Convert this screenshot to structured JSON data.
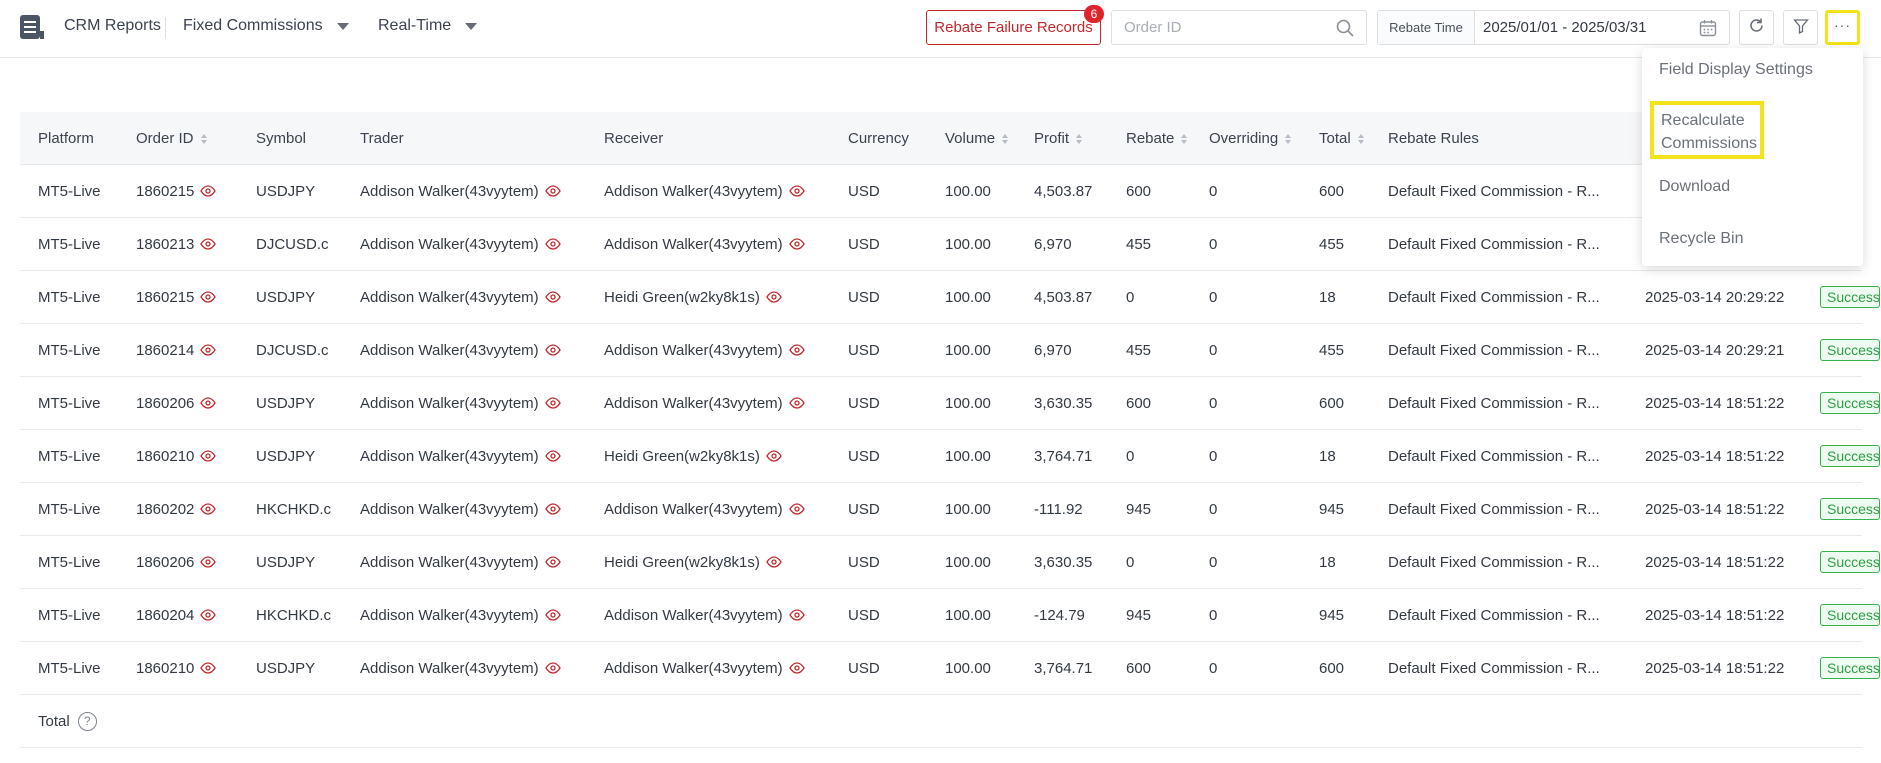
{
  "header": {
    "app_title": "CRM Reports",
    "report_type": "Fixed Commissions",
    "mode": "Real-Time",
    "failure_button": "Rebate Failure Records",
    "failure_count": "6",
    "search_placeholder": "Order ID",
    "date_label": "Rebate Time",
    "date_range": "2025/01/01 - 2025/03/31",
    "more_label": "···"
  },
  "menu": {
    "items": [
      "Field Display Settings",
      "Recalculate Commissions",
      "Download",
      "Recycle Bin"
    ]
  },
  "table": {
    "columns": [
      "Platform",
      "Order ID",
      "Symbol",
      "Trader",
      "Receiver",
      "Currency",
      "Volume",
      "Profit",
      "Rebate",
      "Overriding",
      "Total",
      "Rebate Rules"
    ],
    "rows": [
      {
        "platform": "MT5-Live",
        "order_id": "1860215",
        "symbol": "USDJPY",
        "trader": "Addison Walker(43vyytem)",
        "receiver": "Addison Walker(43vyytem)",
        "currency": "USD",
        "volume": "100.00",
        "profit": "4,503.87",
        "rebate": "600",
        "overriding": "0",
        "total": "600",
        "rule": "Default Fixed Commission - R...",
        "time": "",
        "status": ""
      },
      {
        "platform": "MT5-Live",
        "order_id": "1860213",
        "symbol": "DJCUSD.c",
        "trader": "Addison Walker(43vyytem)",
        "receiver": "Addison Walker(43vyytem)",
        "currency": "USD",
        "volume": "100.00",
        "profit": "6,970",
        "rebate": "455",
        "overriding": "0",
        "total": "455",
        "rule": "Default Fixed Commission - R...",
        "time": "",
        "status": ""
      },
      {
        "platform": "MT5-Live",
        "order_id": "1860215",
        "symbol": "USDJPY",
        "trader": "Addison Walker(43vyytem)",
        "receiver": "Heidi Green(w2ky8k1s)",
        "currency": "USD",
        "volume": "100.00",
        "profit": "4,503.87",
        "rebate": "0",
        "overriding": "0",
        "total": "18",
        "rule": "Default Fixed Commission - R...",
        "time": "2025-03-14 20:29:22",
        "status": "Success"
      },
      {
        "platform": "MT5-Live",
        "order_id": "1860214",
        "symbol": "DJCUSD.c",
        "trader": "Addison Walker(43vyytem)",
        "receiver": "Addison Walker(43vyytem)",
        "currency": "USD",
        "volume": "100.00",
        "profit": "6,970",
        "rebate": "455",
        "overriding": "0",
        "total": "455",
        "rule": "Default Fixed Commission - R...",
        "time": "2025-03-14 20:29:21",
        "status": "Success"
      },
      {
        "platform": "MT5-Live",
        "order_id": "1860206",
        "symbol": "USDJPY",
        "trader": "Addison Walker(43vyytem)",
        "receiver": "Addison Walker(43vyytem)",
        "currency": "USD",
        "volume": "100.00",
        "profit": "3,630.35",
        "rebate": "600",
        "overriding": "0",
        "total": "600",
        "rule": "Default Fixed Commission - R...",
        "time": "2025-03-14 18:51:22",
        "status": "Success"
      },
      {
        "platform": "MT5-Live",
        "order_id": "1860210",
        "symbol": "USDJPY",
        "trader": "Addison Walker(43vyytem)",
        "receiver": "Heidi Green(w2ky8k1s)",
        "currency": "USD",
        "volume": "100.00",
        "profit": "3,764.71",
        "rebate": "0",
        "overriding": "0",
        "total": "18",
        "rule": "Default Fixed Commission - R...",
        "time": "2025-03-14 18:51:22",
        "status": "Success"
      },
      {
        "platform": "MT5-Live",
        "order_id": "1860202",
        "symbol": "HKCHKD.c",
        "trader": "Addison Walker(43vyytem)",
        "receiver": "Addison Walker(43vyytem)",
        "currency": "USD",
        "volume": "100.00",
        "profit": "-111.92",
        "rebate": "945",
        "overriding": "0",
        "total": "945",
        "rule": "Default Fixed Commission - R...",
        "time": "2025-03-14 18:51:22",
        "status": "Success"
      },
      {
        "platform": "MT5-Live",
        "order_id": "1860206",
        "symbol": "USDJPY",
        "trader": "Addison Walker(43vyytem)",
        "receiver": "Heidi Green(w2ky8k1s)",
        "currency": "USD",
        "volume": "100.00",
        "profit": "3,630.35",
        "rebate": "0",
        "overriding": "0",
        "total": "18",
        "rule": "Default Fixed Commission - R...",
        "time": "2025-03-14 18:51:22",
        "status": "Success"
      },
      {
        "platform": "MT5-Live",
        "order_id": "1860204",
        "symbol": "HKCHKD.c",
        "trader": "Addison Walker(43vyytem)",
        "receiver": "Addison Walker(43vyytem)",
        "currency": "USD",
        "volume": "100.00",
        "profit": "-124.79",
        "rebate": "945",
        "overriding": "0",
        "total": "945",
        "rule": "Default Fixed Commission - R...",
        "time": "2025-03-14 18:51:22",
        "status": "Success"
      },
      {
        "platform": "MT5-Live",
        "order_id": "1860210",
        "symbol": "USDJPY",
        "trader": "Addison Walker(43vyytem)",
        "receiver": "Addison Walker(43vyytem)",
        "currency": "USD",
        "volume": "100.00",
        "profit": "3,764.71",
        "rebate": "600",
        "overriding": "0",
        "total": "600",
        "rule": "Default Fixed Commission - R...",
        "time": "2025-03-14 18:51:22",
        "status": "Success"
      }
    ],
    "total_label": "Total",
    "help_glyph": "?"
  },
  "colors": {
    "accent_red": "#c0282d",
    "highlight_yellow": "#f4e21a",
    "success_green": "#2f9e44"
  },
  "icons": [
    "menu-logo-icon",
    "caret-down-icon",
    "search-icon",
    "calendar-icon",
    "refresh-icon",
    "filter-icon",
    "eye-icon",
    "help-icon"
  ]
}
